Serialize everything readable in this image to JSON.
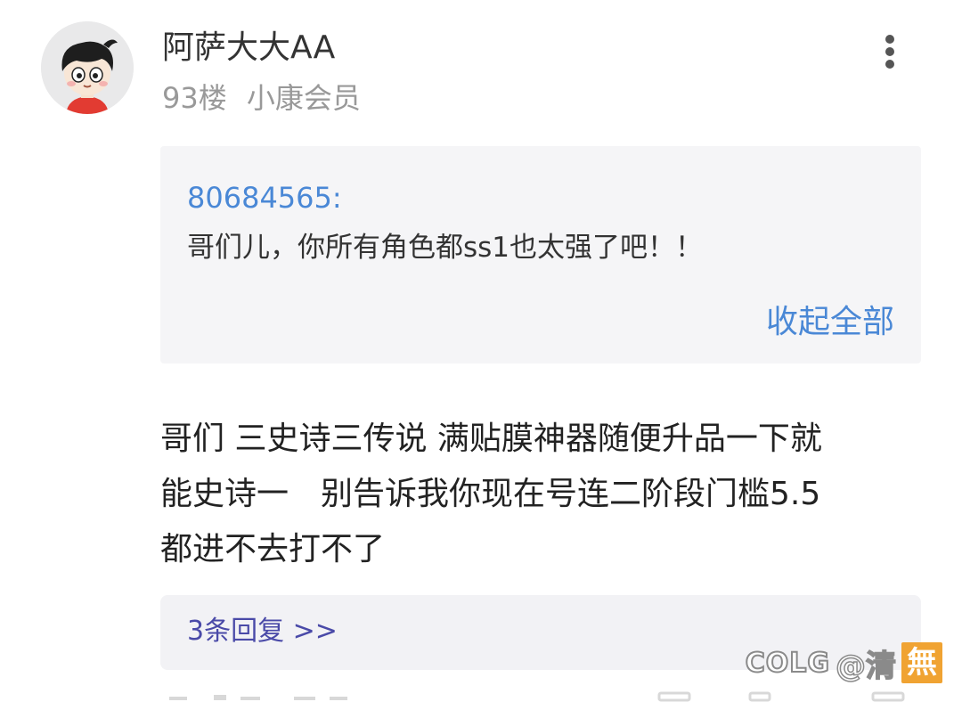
{
  "post": {
    "username": "阿萨大大AA",
    "floor": "93楼",
    "member_level": "小康会员",
    "quote": {
      "author": "80684565:",
      "text": "哥们儿，你所有角色都ss1也太强了吧！！",
      "collapse_label": "收起全部"
    },
    "body_lines": [
      "哥们 三史诗三传说 满贴膜神器随便升品一下就",
      "能史诗一　别告诉我你现在号连二阶段门槛5.5",
      "都进不去打不了"
    ],
    "replies_label": "3条回复 >>"
  },
  "watermark": {
    "brand": "COLG",
    "at_user": "@清",
    "seal_char": "無"
  },
  "icons": {
    "avatar": "cartoon-boy-avatar",
    "more": "vertical-ellipsis-icon"
  },
  "colors": {
    "link_blue": "#4a88d6",
    "reply_link": "#4a4aa8",
    "meta_gray": "#999999",
    "quote_bg": "#f5f5f7",
    "seal_orange": "#f0a332"
  }
}
